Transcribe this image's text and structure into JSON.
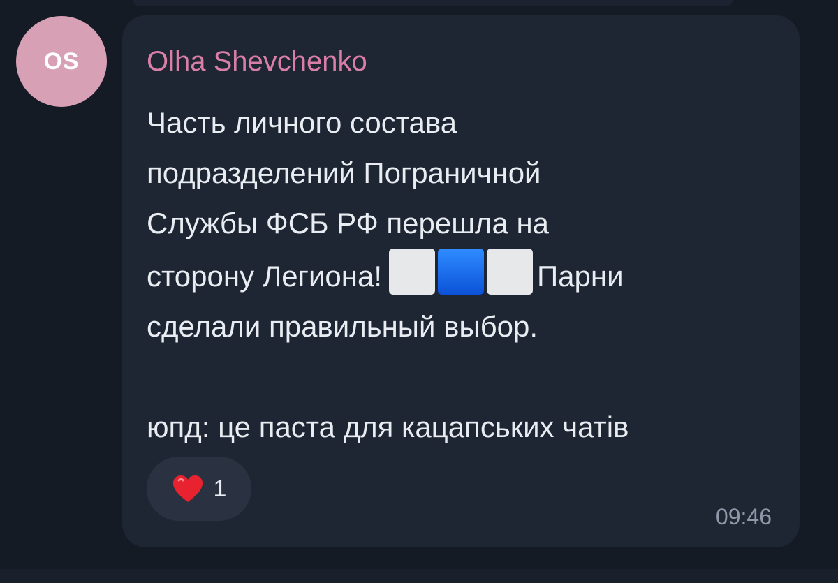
{
  "avatar": {
    "initials": "OS",
    "color": "#d8a0b4"
  },
  "message": {
    "sender": "Olha Shevchenko",
    "sender_color": "#d97fa7",
    "line1": "Часть личного состава",
    "line2": "подразделений Пограничной",
    "line3": "Службы ФСБ РФ перешла на",
    "line4_before_flag": "сторону Легиона!",
    "line4_after_flag": "Парни",
    "line5": "сделали правильный выбор.",
    "postscript": "юпд: це паста для кацапських чатів",
    "flag_icon": "white-blue-white-flag-emoji",
    "time": "09:46"
  },
  "reaction": {
    "icon": "heart-icon",
    "count": "1"
  }
}
